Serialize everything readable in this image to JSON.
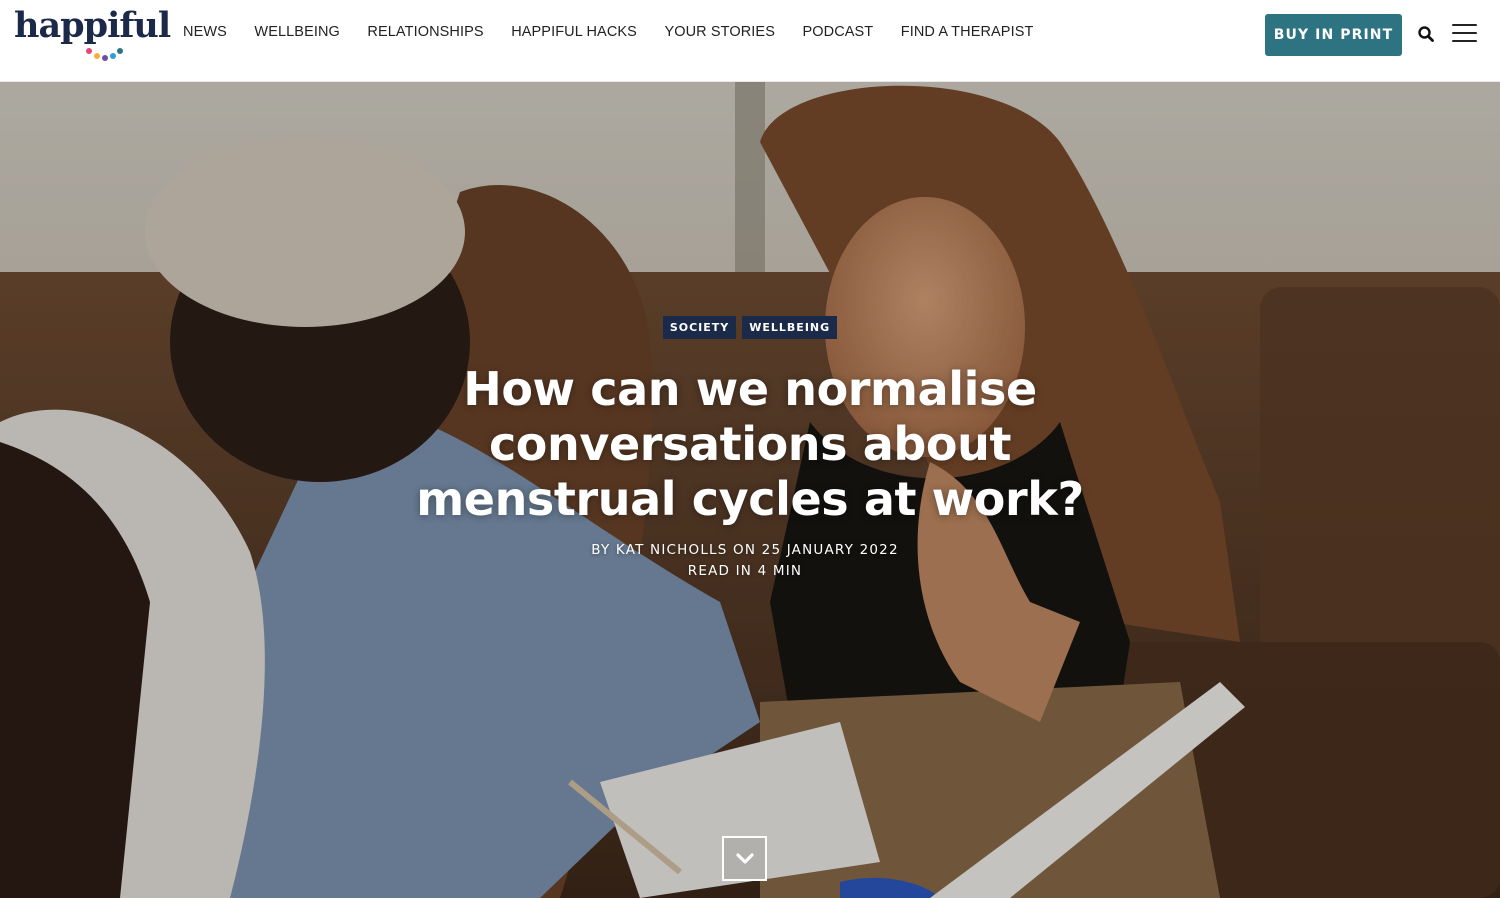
{
  "brand": {
    "logo_text": "happiful",
    "dot_colors": [
      "#e8457a",
      "#f4b03b",
      "#6b4fa8",
      "#2e9fd6",
      "#2e7382"
    ]
  },
  "nav": {
    "items": [
      "NEWS",
      "WELLBEING",
      "RELATIONSHIPS",
      "HAPPIFUL HACKS",
      "YOUR STORIES",
      "PODCAST",
      "FIND A THERAPIST"
    ]
  },
  "header": {
    "buy_label": "BUY IN PRINT",
    "buy_color": "#2e7382",
    "search_icon": "search-icon",
    "menu_icon": "hamburger-menu-icon"
  },
  "article": {
    "tags": [
      "SOCIETY",
      "WELLBEING"
    ],
    "tag_color": "#1c2a4a",
    "title": "How can we normalise conversations about menstrual cycles at work?",
    "byline": "BY KAT NICHOLLS ON 25 JANUARY 2022",
    "read_time": "READ IN 4 MIN",
    "scroll_icon": "chevron-down-icon"
  }
}
